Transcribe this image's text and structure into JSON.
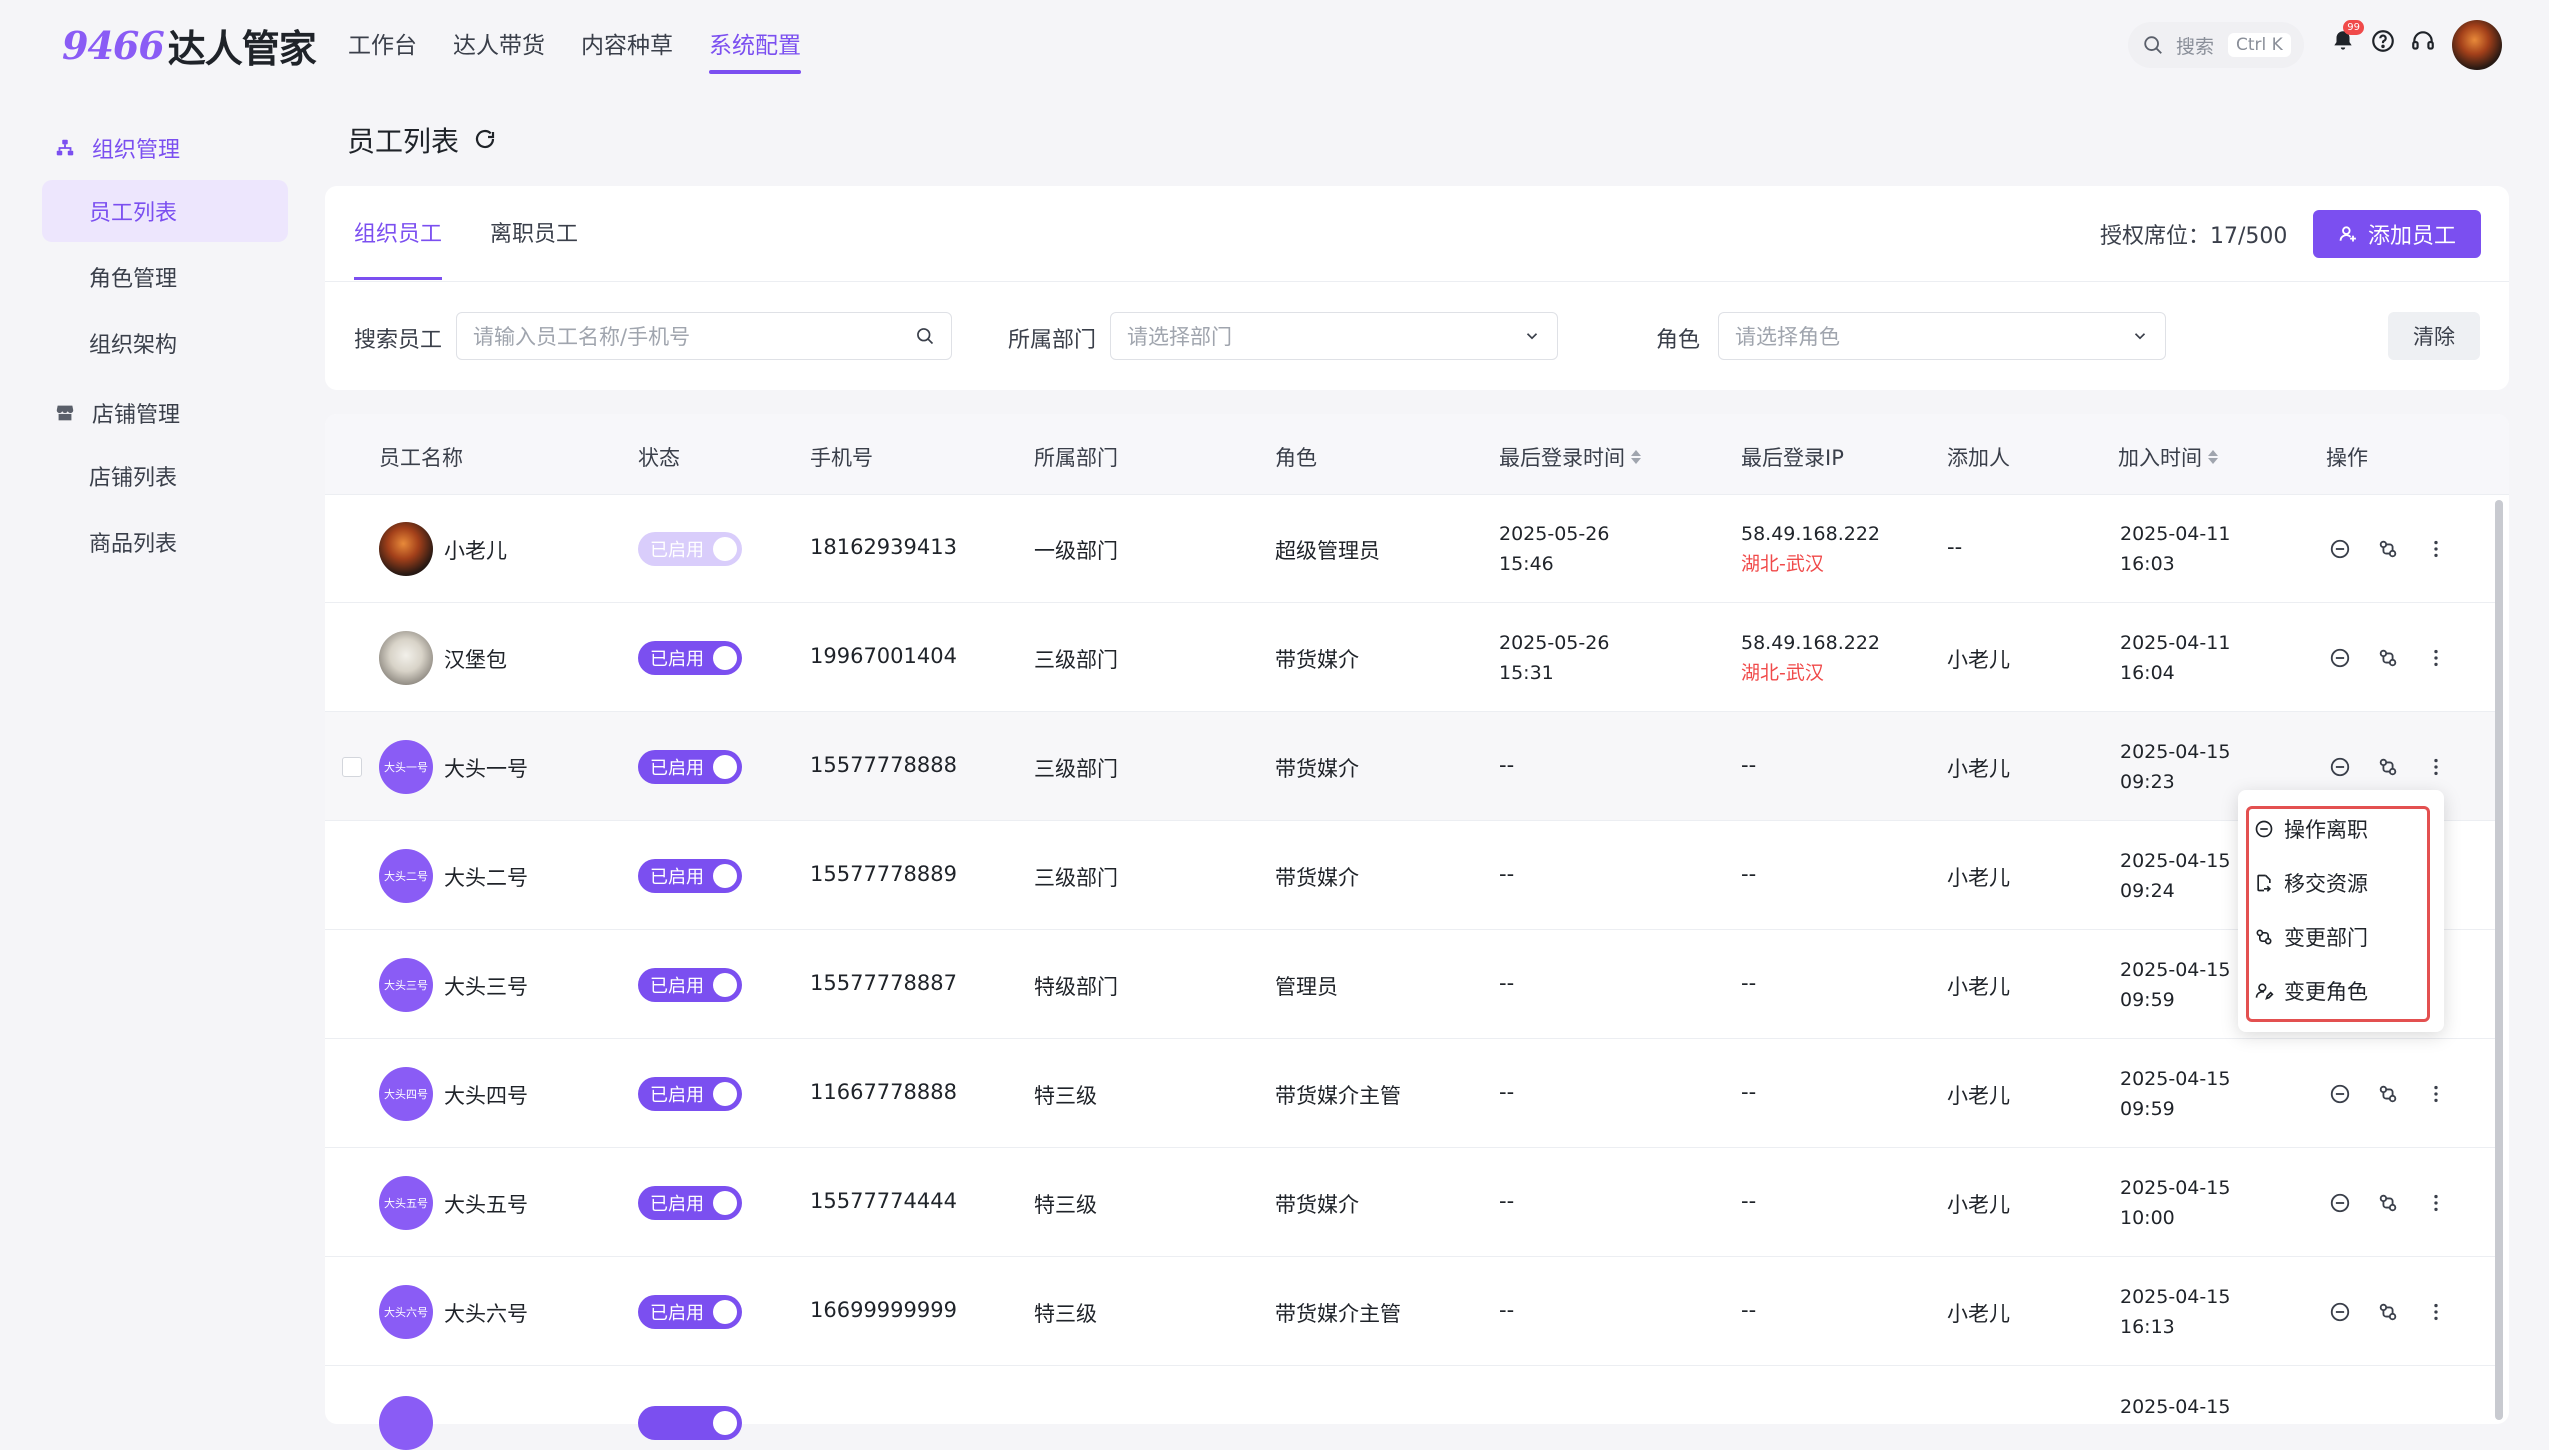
{
  "app": {
    "logo_num": "9466",
    "logo_text": "达人管家"
  },
  "topnav": [
    {
      "label": "工作台"
    },
    {
      "label": "达人带货"
    },
    {
      "label": "内容种草"
    },
    {
      "label": "系统配置"
    }
  ],
  "search": {
    "label": "搜索",
    "shortcut": "Ctrl K"
  },
  "notifications": {
    "badge": "99"
  },
  "sidebar": {
    "group1": "组织管理",
    "group1_items": [
      "员工列表",
      "角色管理",
      "组织架构"
    ],
    "group2": "店铺管理",
    "group2_items": [
      "店铺列表",
      "商品列表"
    ]
  },
  "page": {
    "title": "员工列表"
  },
  "tabs": [
    "组织员工",
    "离职员工"
  ],
  "seat": "授权席位：17/500",
  "add_button": "添加员工",
  "filters": {
    "search_label": "搜索员工",
    "search_placeholder": "请输入员工名称/手机号",
    "dept_label": "所属部门",
    "dept_placeholder": "请选择部门",
    "role_label": "角色",
    "role_placeholder": "请选择角色",
    "clear": "清除"
  },
  "table": {
    "headers": [
      "员工名称",
      "状态",
      "手机号",
      "所属部门",
      "角色",
      "最后登录时间",
      "最后登录IP",
      "添加人",
      "加入时间",
      "操作"
    ],
    "rows": [
      {
        "avatar_text": "",
        "name": "小老儿",
        "status": "已启用",
        "phone": "18162939413",
        "dept": "一级部门",
        "role": "超级管理员",
        "login_date": "2025-05-26",
        "login_time": "15:46",
        "ip": "58.49.168.222",
        "ip_loc": "湖北-武汉",
        "adder": "--",
        "join_date": "2025-04-11",
        "join_time": "16:03"
      },
      {
        "avatar_text": "",
        "name": "汉堡包",
        "status": "已启用",
        "phone": "19967001404",
        "dept": "三级部门",
        "role": "带货媒介",
        "login_date": "2025-05-26",
        "login_time": "15:31",
        "ip": "58.49.168.222",
        "ip_loc": "湖北-武汉",
        "adder": "小老儿",
        "join_date": "2025-04-11",
        "join_time": "16:04"
      },
      {
        "avatar_text": "大头一号",
        "name": "大头一号",
        "status": "已启用",
        "phone": "15577778888",
        "dept": "三级部门",
        "role": "带货媒介",
        "login_date": "--",
        "login_time": "",
        "ip": "--",
        "ip_loc": "",
        "adder": "小老儿",
        "join_date": "2025-04-15",
        "join_time": "09:23"
      },
      {
        "avatar_text": "大头二号",
        "name": "大头二号",
        "status": "已启用",
        "phone": "15577778889",
        "dept": "三级部门",
        "role": "带货媒介",
        "login_date": "--",
        "login_time": "",
        "ip": "--",
        "ip_loc": "",
        "adder": "小老儿",
        "join_date": "2025-04-15",
        "join_time": "09:24"
      },
      {
        "avatar_text": "大头三号",
        "name": "大头三号",
        "status": "已启用",
        "phone": "15577778887",
        "dept": "特级部门",
        "role": "管理员",
        "login_date": "--",
        "login_time": "",
        "ip": "--",
        "ip_loc": "",
        "adder": "小老儿",
        "join_date": "2025-04-15",
        "join_time": "09:59"
      },
      {
        "avatar_text": "大头四号",
        "name": "大头四号",
        "status": "已启用",
        "phone": "11667778888",
        "dept": "特三级",
        "role": "带货媒介主管",
        "login_date": "--",
        "login_time": "",
        "ip": "--",
        "ip_loc": "",
        "adder": "小老儿",
        "join_date": "2025-04-15",
        "join_time": "09:59"
      },
      {
        "avatar_text": "大头五号",
        "name": "大头五号",
        "status": "已启用",
        "phone": "15577774444",
        "dept": "特三级",
        "role": "带货媒介",
        "login_date": "--",
        "login_time": "",
        "ip": "--",
        "ip_loc": "",
        "adder": "小老儿",
        "join_date": "2025-04-15",
        "join_time": "10:00"
      },
      {
        "avatar_text": "大头六号",
        "name": "大头六号",
        "status": "已启用",
        "phone": "16699999999",
        "dept": "特三级",
        "role": "带货媒介主管",
        "login_date": "--",
        "login_time": "",
        "ip": "--",
        "ip_loc": "",
        "adder": "小老儿",
        "join_date": "2025-04-15",
        "join_time": "16:13"
      }
    ],
    "partial_row_join": "2025-04-15"
  },
  "menu": [
    "操作离职",
    "移交资源",
    "变更部门",
    "变更角色"
  ],
  "colors": {
    "accent": "#7b4ff0",
    "danger": "#f04a4a",
    "highlight": "#e35050"
  }
}
